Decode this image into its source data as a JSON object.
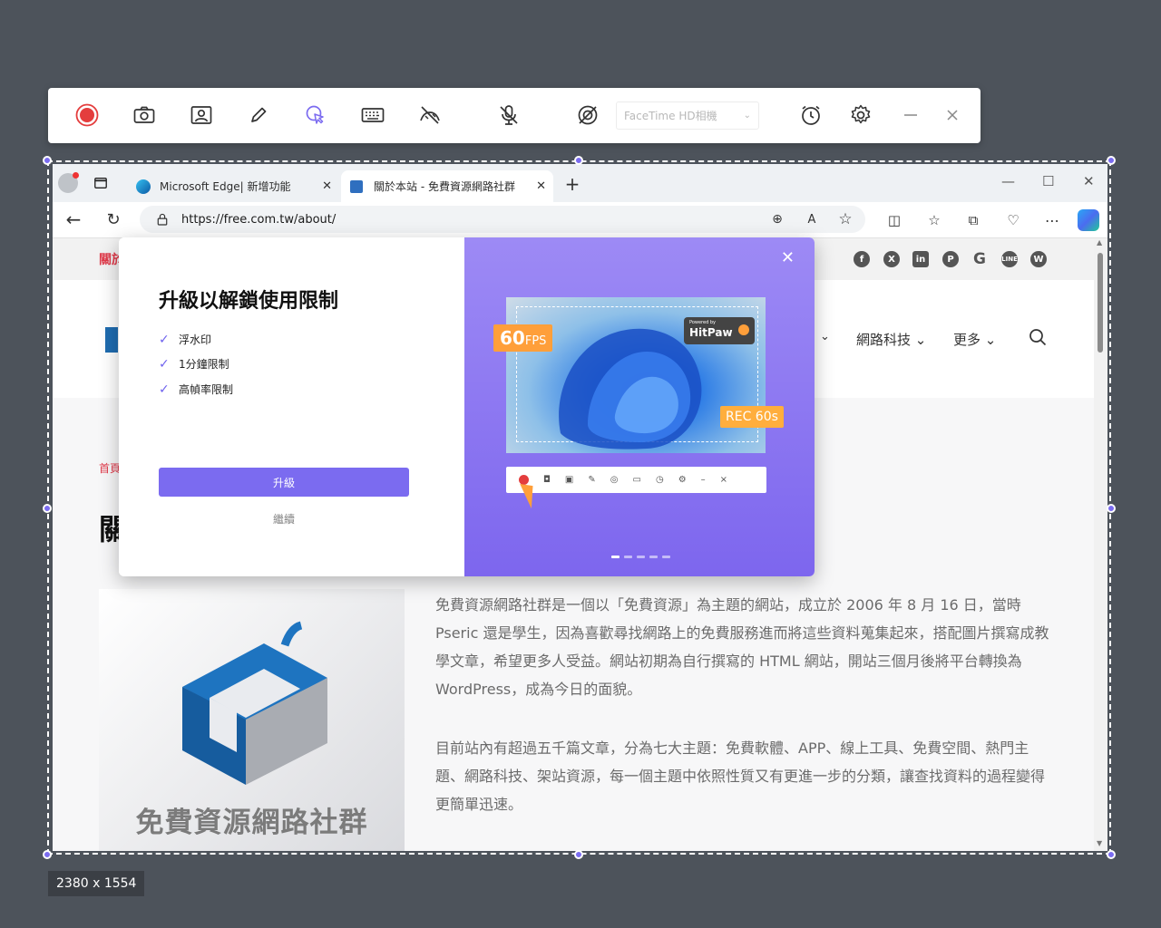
{
  "recorder": {
    "camera_select": "FaceTime HD相機",
    "icons": [
      "record-icon",
      "camera-icon",
      "webcam-icon",
      "pen-icon",
      "click-effect-icon",
      "keyboard-icon",
      "hide-cursor-icon",
      "mic-off-icon",
      "cursor-off-icon",
      "camera-select",
      "timer-icon",
      "settings-icon",
      "minimize-icon",
      "close-icon"
    ]
  },
  "capture": {
    "size_label": "2380 x 1554"
  },
  "browser": {
    "tabs": [
      {
        "label": "Microsoft Edge| 新增功能"
      },
      {
        "label": "關於本站 - 免費資源網路社群"
      }
    ],
    "url": "https://free.com.tw/about/"
  },
  "site": {
    "top_left_text": "關於",
    "breadcrumb": "首頁",
    "title_char": "關",
    "nav": [
      "網路科技",
      "更多"
    ],
    "image_caption": "免費資源網路社群",
    "paragraphs": [
      "免費資源網路社群是一個以「免費資源」為主題的網站，成立於 2006 年 8 月 16 日，當時 Pseric 還是學生，因為喜歡尋找網路上的免費服務進而將這些資料蒐集起來，搭配圖片撰寫成教學文章，希望更多人受益。網站初期為自行撰寫的 HTML 網站，開站三個月後將平台轉換為 WordPress，成為今日的面貌。",
      "目前站內有超過五千篇文章，分為七大主題：免費軟體、APP、線上工具、免費空間、熱門主題、網路科技、架站資源，每一個主題中依照性質又有更進一步的分類，讓查找資料的過程變得更簡單迅速。"
    ]
  },
  "modal": {
    "title": "升級以解鎖使用限制",
    "features": [
      "浮水印",
      "1分鐘限制",
      "高幀率限制"
    ],
    "upgrade_label": "升級",
    "continue_label": "繼續",
    "promo": {
      "fps_number": "60",
      "fps_unit": "FPS",
      "rec_label": "REC 60s",
      "brand_small": "Powered by",
      "brand": "HitPaw"
    },
    "slide_count": 5,
    "slide_active": 1
  },
  "colors": {
    "accent": "#7b6bf0",
    "record": "#e43d3d",
    "promo_orange": "#ff9f3a"
  }
}
